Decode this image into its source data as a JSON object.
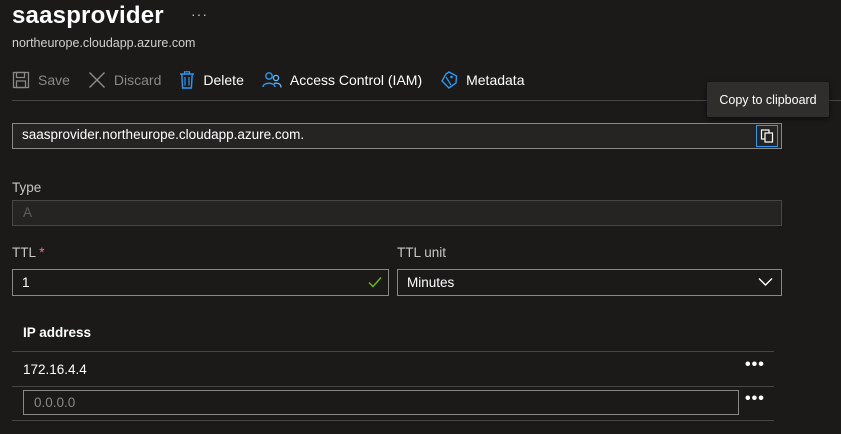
{
  "header": {
    "title": "saasprovider",
    "more": "···",
    "subtitle": "northeurope.cloudapp.azure.com"
  },
  "toolbar": {
    "save_label": "Save",
    "discard_label": "Discard",
    "delete_label": "Delete",
    "access_control_label": "Access Control (IAM)",
    "metadata_label": "Metadata"
  },
  "tooltip": {
    "text": "Copy to clipboard"
  },
  "fqdn": {
    "value": "saasprovider.northeurope.cloudapp.azure.com."
  },
  "type": {
    "label": "Type",
    "value": "A"
  },
  "ttl": {
    "label": "TTL",
    "required_mark": "*",
    "value": "1"
  },
  "ttl_unit": {
    "label": "TTL unit",
    "value": "Minutes"
  },
  "ip_table": {
    "header": "IP address",
    "rows": [
      {
        "value": "172.16.4.4",
        "more": "•••"
      }
    ],
    "new_row": {
      "placeholder": "0.0.0.0",
      "more": "•••"
    }
  },
  "colors": {
    "background": "#1b1a19",
    "accent": "#2899f5",
    "required": "#f1707b",
    "valid": "#6bb700"
  }
}
